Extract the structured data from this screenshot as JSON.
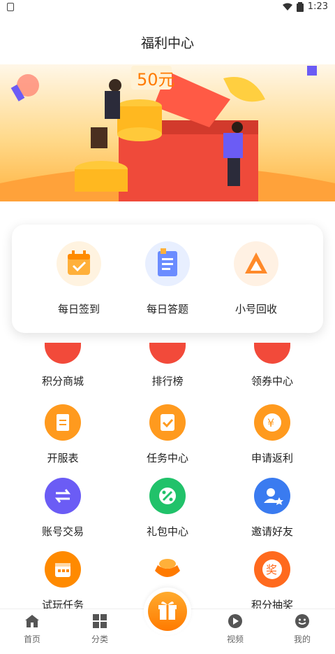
{
  "status_bar": {
    "time": "1:23"
  },
  "header": {
    "title": "福利中心"
  },
  "banner": {
    "price_text": "50元"
  },
  "featured": [
    {
      "label": "每日签到",
      "icon": "calendar-check-icon"
    },
    {
      "label": "每日答题",
      "icon": "quiz-list-icon"
    },
    {
      "label": "小号回收",
      "icon": "recycle-triangle-icon"
    }
  ],
  "grid": [
    {
      "label": "积分商城",
      "icon": "points-mall-icon"
    },
    {
      "label": "排行榜",
      "icon": "ranking-icon"
    },
    {
      "label": "领券中心",
      "icon": "coupon-icon"
    },
    {
      "label": "开服表",
      "icon": "server-schedule-icon"
    },
    {
      "label": "任务中心",
      "icon": "task-check-icon"
    },
    {
      "label": "申请返利",
      "icon": "yen-coin-icon"
    },
    {
      "label": "账号交易",
      "icon": "exchange-arrows-icon"
    },
    {
      "label": "礼包中心",
      "icon": "gift-pack-icon"
    },
    {
      "label": "邀请好友",
      "icon": "invite-friend-icon"
    },
    {
      "label": "试玩任务",
      "icon": "trial-calendar-icon"
    },
    {
      "label": "",
      "icon": "gold-ingot-icon"
    },
    {
      "label": "积分抽奖",
      "icon": "lottery-prize-icon"
    }
  ],
  "tabbar": {
    "home": "首页",
    "category": "分类",
    "video": "视频",
    "mine": "我的"
  },
  "colors": {
    "orange": "#ff8a00",
    "purple": "#6b5cf5",
    "green": "#21c26a",
    "blue": "#3a7bf0",
    "red": "#f24a3a"
  }
}
